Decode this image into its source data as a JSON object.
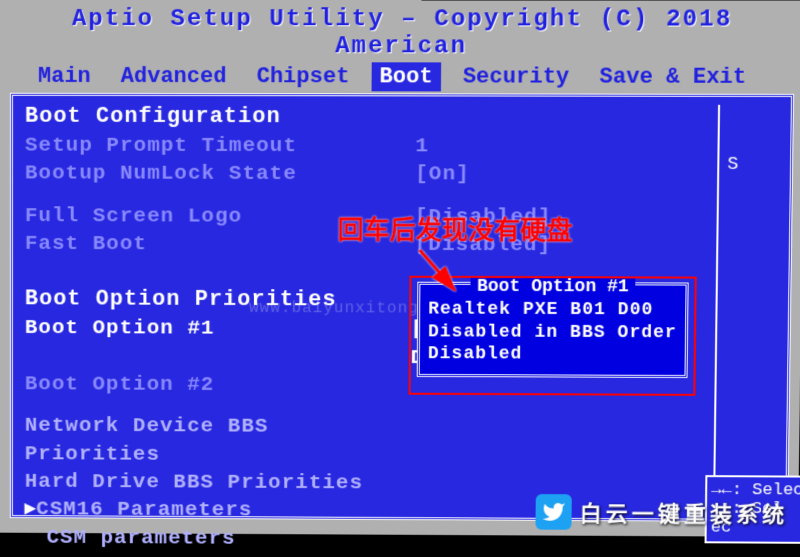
{
  "header": {
    "title": "Aptio Setup Utility – Copyright (C) 2018 American"
  },
  "menu": {
    "items": [
      "Main",
      "Advanced",
      "Chipset",
      "Boot",
      "Security",
      "Save & Exit"
    ],
    "active": "Boot"
  },
  "boot_config": {
    "section_title": "Boot Configuration",
    "setup_prompt": {
      "label": "Setup Prompt Timeout",
      "value": "1"
    },
    "numlock": {
      "label": "Bootup NumLock State",
      "value": "[On]"
    },
    "full_screen_logo": {
      "label": "Full Screen Logo",
      "value": "[Disabled]"
    },
    "fast_boot": {
      "label": "Fast Boot",
      "value": "[Disabled]"
    }
  },
  "priorities": {
    "section_title": "Boot Option Priorities",
    "opt1": {
      "label": "Boot Option #1",
      "value": "[Realtek PXE B01 D00]"
    },
    "opt2": {
      "label": "Boot Option #2",
      "value": ""
    }
  },
  "submenu": {
    "net_bbs": "Network Device BBS Priorities",
    "hdd_bbs": "Hard Drive BBS Priorities",
    "csm16": "CSM16 Parameters",
    "csm": "CSM parameters"
  },
  "popup": {
    "title": "Boot Option #1",
    "options": [
      "Realtek PXE B01 D00",
      "Disabled in BBS Order",
      "Disabled"
    ]
  },
  "annotation": {
    "text": "回车后发现没有硬盘"
  },
  "help": {
    "line1": "→←: Selec",
    "line2": "↑↓: Sel",
    "line3": "ec"
  },
  "watermark": {
    "text": "白云一键重装系统",
    "url": "www.baiyunxitong.com"
  },
  "right_col_hint": "S"
}
